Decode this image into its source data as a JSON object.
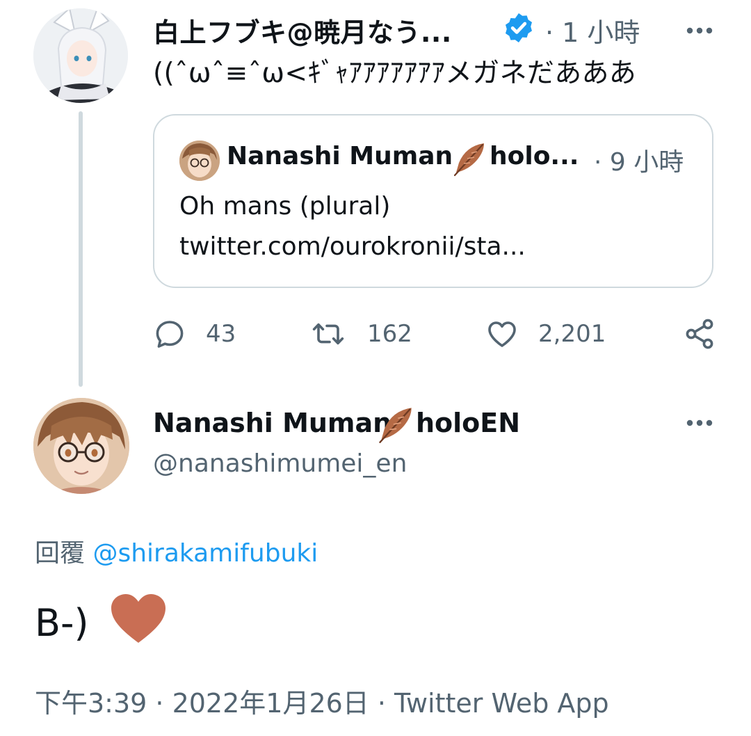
{
  "quoting_tweet": {
    "author_name": "白上フブキ@暁月なう...",
    "verified": true,
    "time": "· 1 小時",
    "text": "((ˆωˆ≡ˆω<ｷﾞｬｱｱｱｱｱｱｱメガネだあああ",
    "quoted": {
      "author_name": "Nanashi Muman",
      "author_name_tail": "holo...",
      "time": "· 9 小時",
      "text": "Oh mans (plural)",
      "link": "twitter.com/ourokronii/sta..."
    },
    "stats": {
      "replies": "43",
      "retweets": "162",
      "likes": "2,201"
    }
  },
  "main_tweet": {
    "author_name": "Nanashi Muman",
    "author_name_tail": "holoEN",
    "handle": "@nanashimumei_en",
    "reply_prefix": "回覆",
    "reply_to": "@shirakamifubuki",
    "text": "B-)",
    "meta": "下午3:39 · 2022年1月26日 · Twitter Web App"
  },
  "icons": {
    "verified": "verified-badge-icon",
    "more": "more-horizontal-icon",
    "feather": "feather-icon",
    "reply": "reply-icon",
    "retweet": "retweet-icon",
    "like": "heart-icon",
    "share": "share-icon"
  },
  "colors": {
    "accent": "#1d9bf0",
    "secondary_text": "#536471",
    "border": "#cfd9de",
    "heart_emoji": "#c96e54"
  }
}
